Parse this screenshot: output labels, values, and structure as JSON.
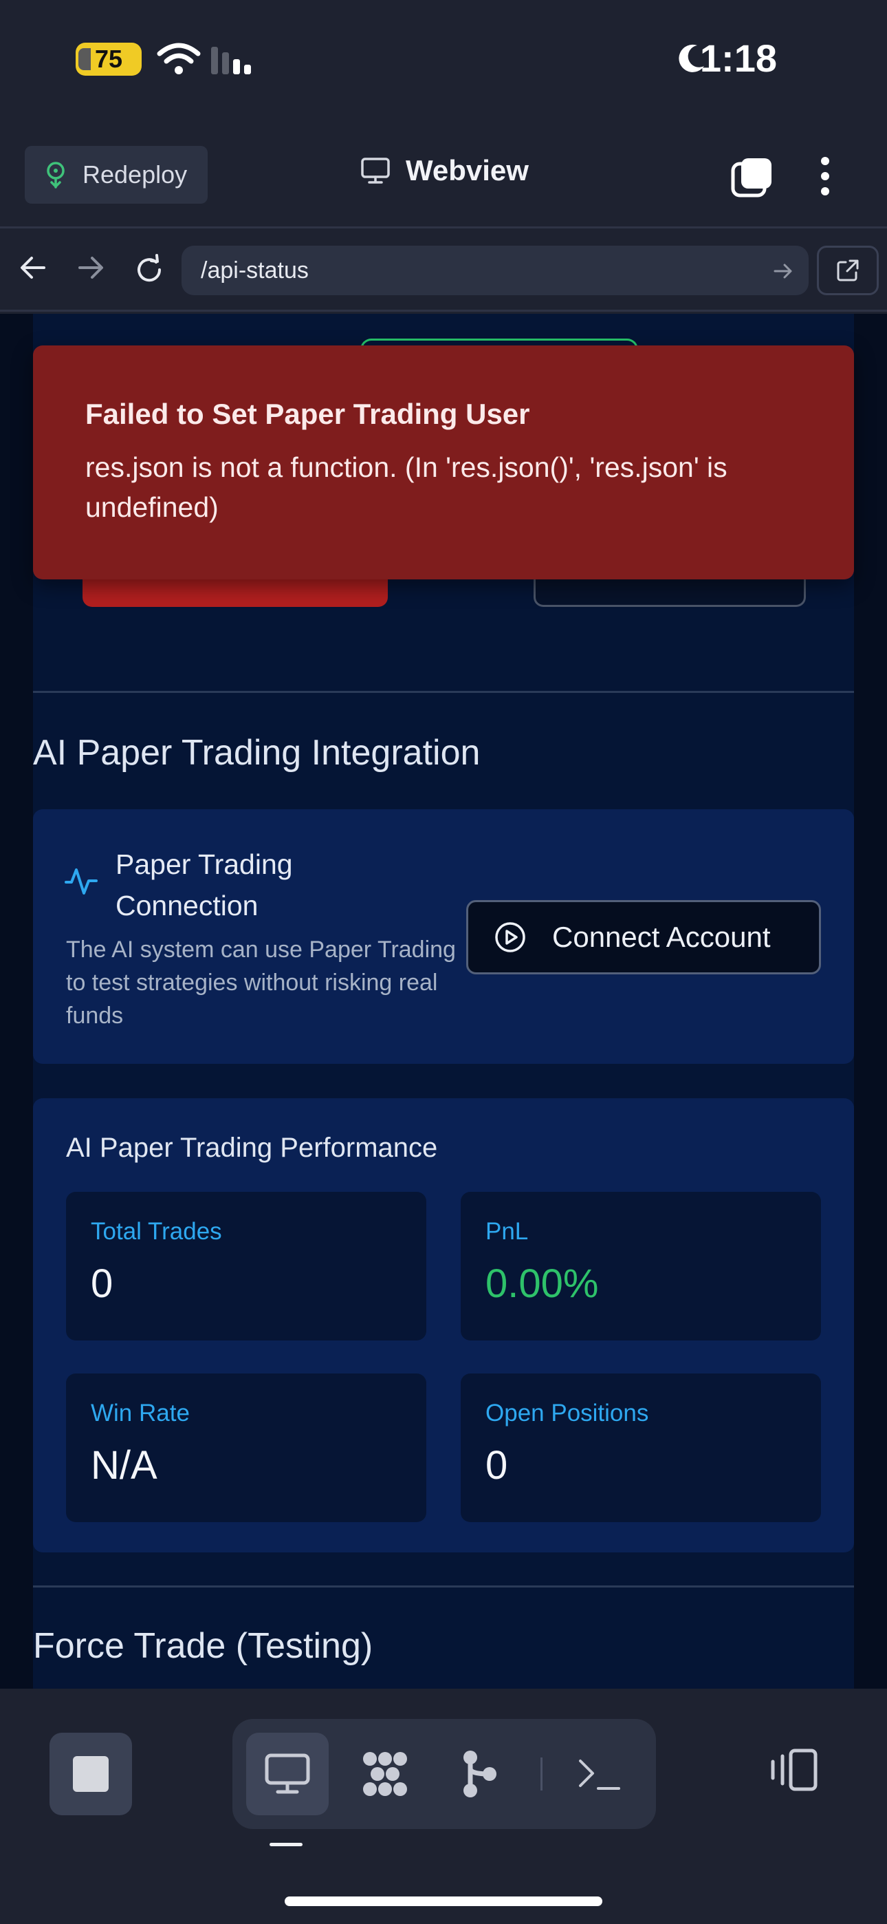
{
  "status_bar": {
    "battery": "75",
    "time": "1:18"
  },
  "header": {
    "redeploy_label": "Redeploy",
    "title": "Webview"
  },
  "address_bar": {
    "url": "/api-status"
  },
  "toast": {
    "title": "Failed to Set Paper Trading User",
    "message": "res.json is not a function. (In 'res.json()', 'res.json' is undefined)"
  },
  "integration": {
    "heading": "AI Paper Trading Integration",
    "connection": {
      "title": "Paper Trading Connection",
      "description": "The AI system can use Paper Trading to test strategies without risking real funds",
      "button_label": "Connect Account"
    },
    "performance": {
      "title": "AI Paper Trading Performance",
      "stats": [
        {
          "label": "Total Trades",
          "value": "0"
        },
        {
          "label": "PnL",
          "value": "0.00%"
        },
        {
          "label": "Win Rate",
          "value": "N/A"
        },
        {
          "label": "Open Positions",
          "value": "0"
        }
      ]
    }
  },
  "force_trade": {
    "heading": "Force Trade (Testing)"
  },
  "colors": {
    "accent_blue": "#2ea8f0",
    "positive_green": "#2ec26a",
    "error_red": "#7f1d1d"
  }
}
